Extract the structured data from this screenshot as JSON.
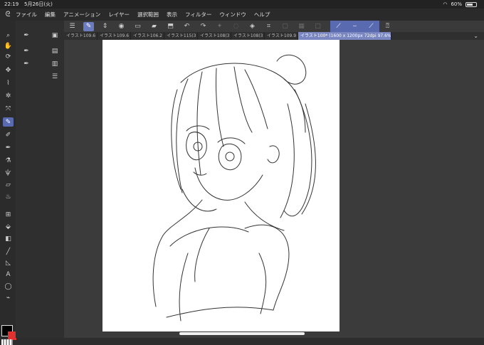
{
  "status": {
    "time": "22:19",
    "date": "5月26日(火)",
    "battery": "60%"
  },
  "menu": [
    "ファイル",
    "編集",
    "アニメーション",
    "レイヤー",
    "選択範囲",
    "表示",
    "フィルター",
    "ウィンドウ",
    "ヘルプ"
  ],
  "tabs": [
    "イラスト109.6",
    "イラスト109.6",
    "イラスト106.2",
    "イラスト115(3",
    "イラスト108(3",
    "イラスト108(3",
    "イラスト109.9",
    "イラスト100* (1600 x 1200px 72dpi 97.6%)"
  ],
  "colors": {
    "accent": "#5a6ab0",
    "foreground": "#000000",
    "background": "#e03030"
  }
}
